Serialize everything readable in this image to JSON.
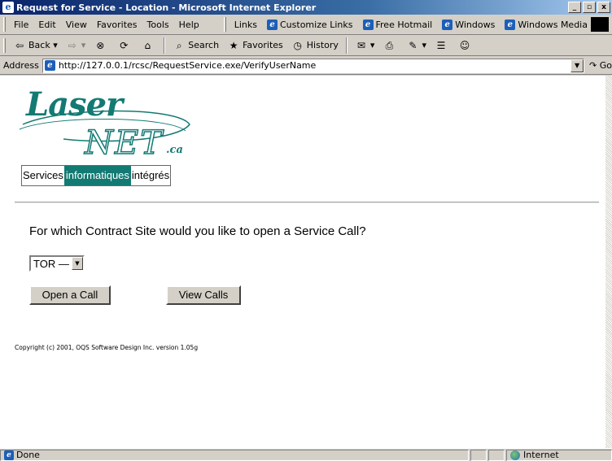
{
  "window": {
    "title": "Request for Service - Location - Microsoft Internet Explorer",
    "minimize": "_",
    "maximize": "▫",
    "close": "x"
  },
  "menu": {
    "items": [
      "File",
      "Edit",
      "View",
      "Favorites",
      "Tools",
      "Help"
    ],
    "links_label": "Links",
    "links": [
      "Customize Links",
      "Free Hotmail",
      "Windows",
      "Windows Media"
    ]
  },
  "toolbar": {
    "back": "Back",
    "search": "Search",
    "favorites": "Favorites",
    "history": "History"
  },
  "address": {
    "label": "Address",
    "url": "http://127.0.0.1/rcsc/RequestService.exe/VerifyUserName",
    "go": "Go"
  },
  "page": {
    "logo": {
      "word1": "Laser",
      "word2": "NET",
      "suffix": ".ca",
      "tagline_left": "Services",
      "tagline_mid": "informatiques",
      "tagline_right": "intégrés"
    },
    "question": "For which Contract Site would you like to open a Service Call?",
    "site_select": {
      "selected": "TOR —"
    },
    "buttons": {
      "open": "Open a Call",
      "view": "View Calls"
    },
    "copyright": "Copyright (c) 2001, OQS Software Design Inc. version 1.05g"
  },
  "status": {
    "text": "Done",
    "zone": "Internet"
  },
  "colors": {
    "brand_teal": "#137a73",
    "titlebar": "#0a246a"
  }
}
